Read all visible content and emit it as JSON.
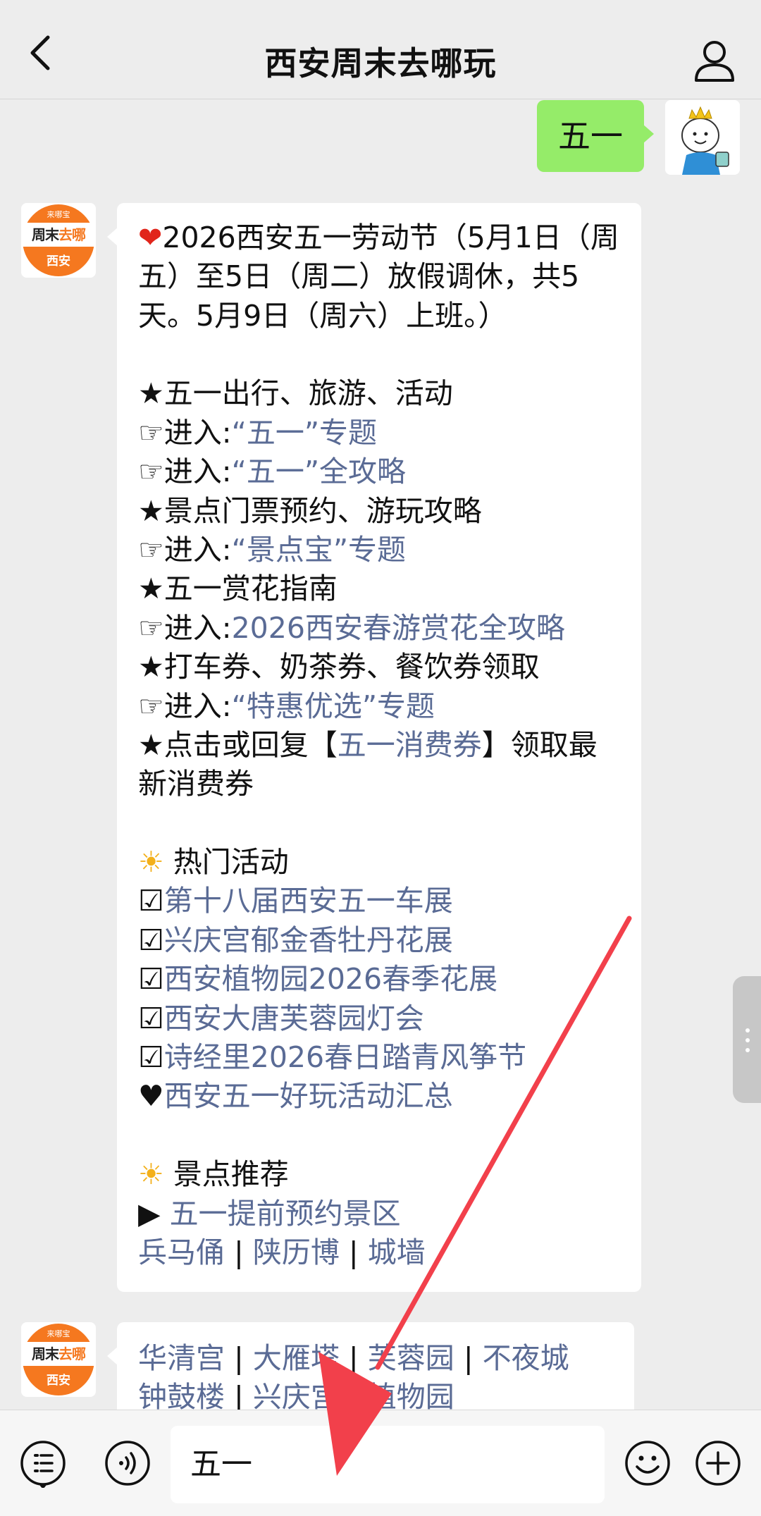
{
  "header": {
    "title": "西安周末去哪玩",
    "back_icon": "chevron-left-icon",
    "profile_icon": "person-icon"
  },
  "user_message": {
    "text": "五一"
  },
  "bot_avatar": {
    "top_text": "来哪宝",
    "brand_part1": "周末",
    "brand_part2": "去哪",
    "city": "西安"
  },
  "reply": {
    "intro": "2026西安五一劳动节（5月1日（周五）至5日（周二）放假调休，共5天。5月9日（周六）上班。）",
    "sections": [
      {
        "star": "★",
        "text": "五一出行、旅游、活动"
      },
      {
        "prefix": "☞进入:",
        "link": "“五一”专题"
      },
      {
        "prefix": "☞进入:",
        "link": "“五一”全攻略"
      },
      {
        "star": "★",
        "text": "景点门票预约、游玩攻略"
      },
      {
        "prefix": "☞进入:",
        "link": "“景点宝”专题"
      },
      {
        "star": "★",
        "text": "五一赏花指南"
      },
      {
        "prefix": "☞进入:",
        "link": "2026西安春游赏花全攻略"
      },
      {
        "star": "★",
        "text": "打车券、奶茶券、餐饮券领取"
      },
      {
        "prefix": "☞进入:",
        "link": "“特惠优选”专题"
      }
    ],
    "coupon": {
      "before": "★点击或回复【",
      "link": "五一消费券",
      "after": "】领取最新消费券"
    },
    "hot_title": "热门活动",
    "hot_items": [
      {
        "mark": "☑",
        "text": "第十八届西安五一车展"
      },
      {
        "mark": "☑",
        "text": "兴庆宫郁金香牡丹花展"
      },
      {
        "mark": "☑",
        "text": "西安植物园2026春季花展"
      },
      {
        "mark": "☑",
        "text": "西安大唐芙蓉园灯会"
      },
      {
        "mark": "☑",
        "text": "诗经里2026春日踏青风筝节"
      },
      {
        "mark": "♥",
        "text": "西安五一好玩活动汇总"
      }
    ],
    "spots_title": "景点推荐",
    "spots_lead": {
      "mark": "▶",
      "text": "五一提前预约景区"
    },
    "spots_row1": [
      "兵马俑",
      "陕历博",
      "城墙"
    ]
  },
  "reply2": {
    "row1": [
      "华清宫",
      "大雁塔",
      "芙蓉园",
      "不夜城"
    ],
    "row2": [
      "钟鼓楼",
      "兴庆宫",
      "植物园"
    ]
  },
  "input_bar": {
    "text": "五一",
    "icons": [
      "menu-list-icon",
      "voice-icon",
      "emoji-icon",
      "plus-icon"
    ]
  },
  "colors": {
    "link": "#5a6b95",
    "bubble_green": "#95ec69",
    "brand_orange": "#f5781f",
    "arrow_red": "#f2404b"
  }
}
